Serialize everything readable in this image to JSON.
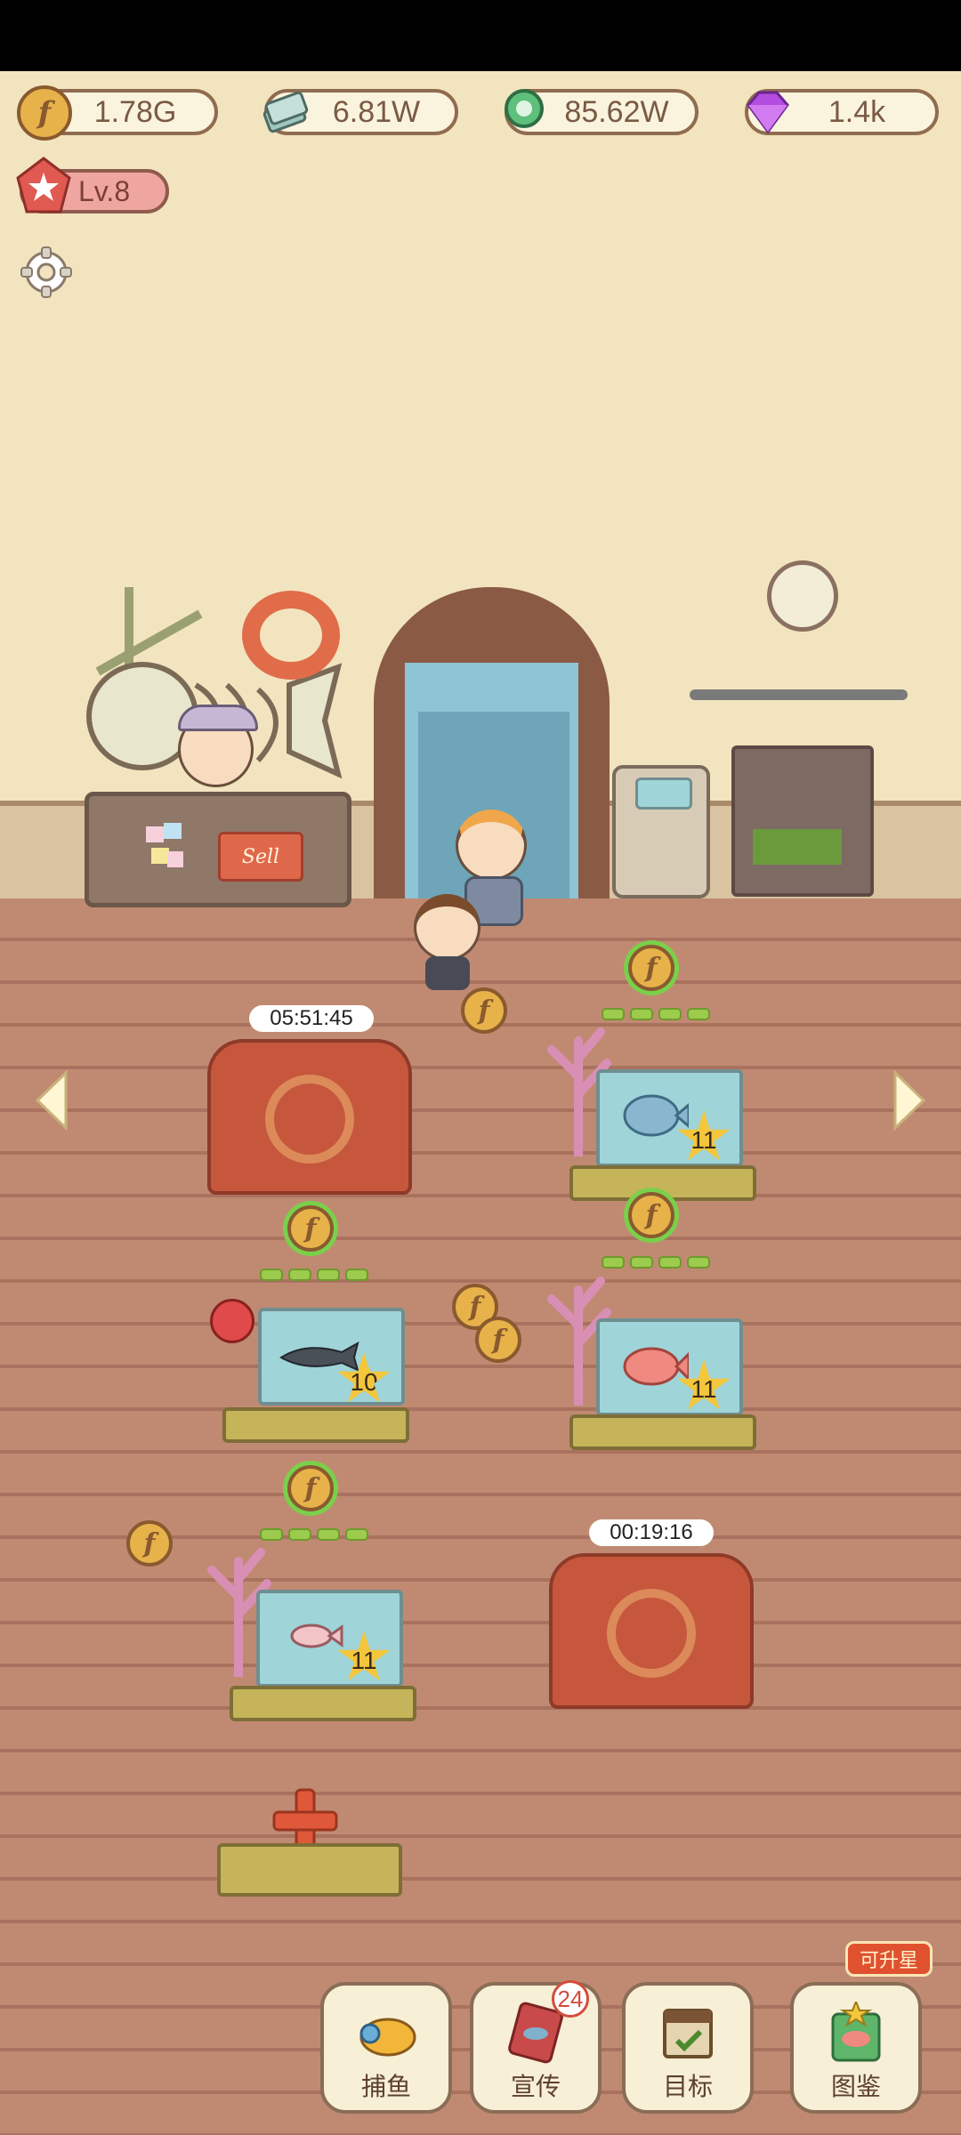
{
  "resources": [
    {
      "name": "coin-icon",
      "value": "1.78G"
    },
    {
      "name": "cash-icon",
      "value": "6.81W"
    },
    {
      "name": "pearl-icon",
      "value": "85.62W"
    },
    {
      "name": "gem-icon",
      "value": "1.4k"
    }
  ],
  "level": {
    "label": "Lv.8"
  },
  "shop_sign": "Sell",
  "coin_glyph": "f",
  "tanks": [
    {
      "slot": "top-left",
      "state": "covered",
      "timer": "05:51:45"
    },
    {
      "slot": "top-right",
      "state": "active",
      "fish": "pufferfish",
      "star_level": "11"
    },
    {
      "slot": "mid-left",
      "state": "active",
      "fish": "shark",
      "star_level": "10"
    },
    {
      "slot": "mid-right",
      "state": "active",
      "fish": "red-spotted-fish",
      "star_level": "11"
    },
    {
      "slot": "bottom-left",
      "state": "active",
      "fish": "pink-fish",
      "star_level": "11"
    },
    {
      "slot": "bottom-right",
      "state": "covered",
      "timer": "00:19:16"
    }
  ],
  "add_tank_icon": "plus-icon",
  "nav": {
    "fishing": {
      "label": "捕鱼"
    },
    "promote": {
      "label": "宣传",
      "badge": "24"
    },
    "goals": {
      "label": "目标"
    },
    "collection": {
      "label": "图鉴",
      "tip": "可升星"
    }
  },
  "colors": {
    "accent_coin": "#e7b24a",
    "floor": "#c08a72",
    "tank_glass": "#9fd4d8",
    "badge_red": "#d44c3c"
  }
}
